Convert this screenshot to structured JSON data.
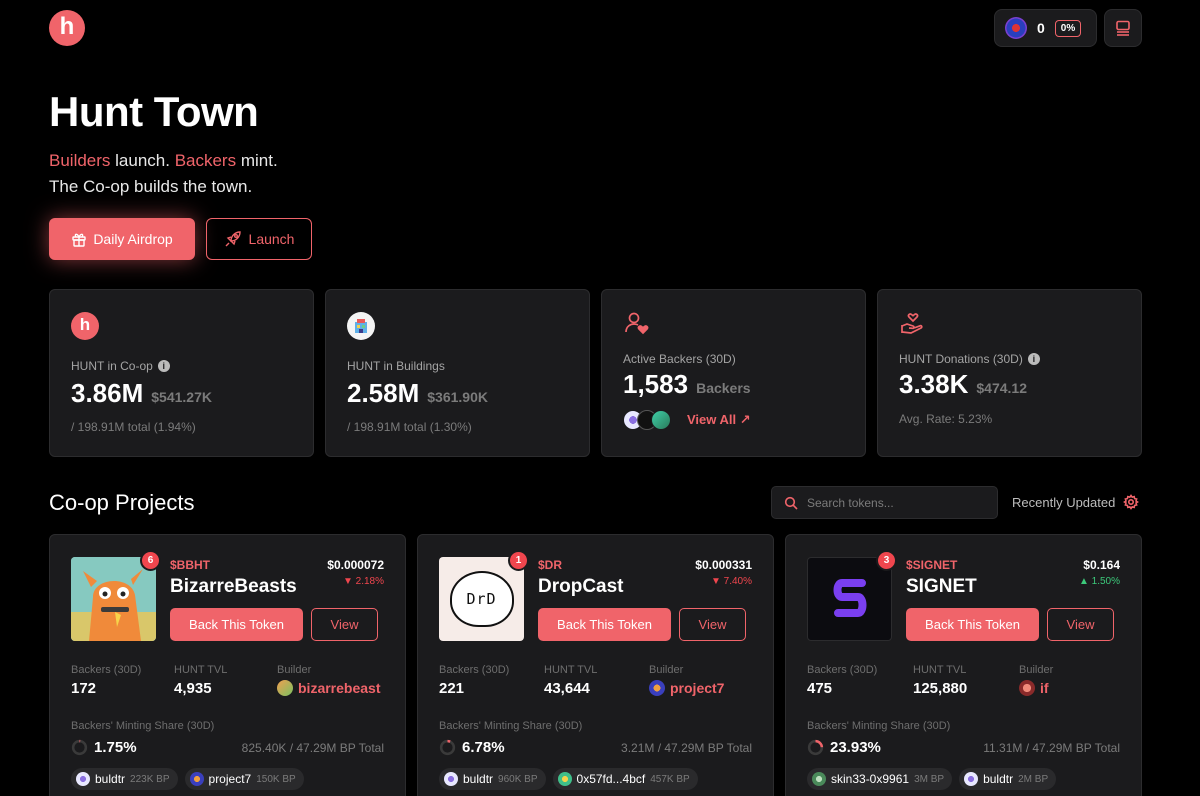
{
  "header": {
    "logo_letter": "h",
    "wallet_count": "0",
    "wallet_pct": "0%"
  },
  "hero": {
    "title": "Hunt Town",
    "line1_builders": "Builders",
    "line1_launch": " launch. ",
    "line1_backers": "Backers",
    "line1_mint": " mint.",
    "line2": "The Co-op builds the town.",
    "airdrop_label": "Daily Airdrop",
    "launch_label": "Launch"
  },
  "stats": [
    {
      "label": "HUNT in Co-op",
      "value": "3.86M",
      "secondary": "$541.27K",
      "foot": "/ 198.91M total (1.94%)",
      "icon": "hunt-logo-icon"
    },
    {
      "label": "HUNT in Buildings",
      "value": "2.58M",
      "secondary": "$361.90K",
      "foot": "/ 198.91M total (1.30%)",
      "icon": "building-icon"
    },
    {
      "label": "Active Backers (30D)",
      "value": "1,583",
      "secondary": "Backers",
      "link": "View All ↗",
      "icon": "user-heart-icon"
    },
    {
      "label": "HUNT Donations (30D)",
      "value": "3.38K",
      "secondary": "$474.12",
      "foot": "Avg. Rate: 5.23%",
      "icon": "hand-heart-icon"
    }
  ],
  "projects_section": {
    "title": "Co-op Projects",
    "search_placeholder": "Search tokens...",
    "sort_label": "Recently Updated"
  },
  "projects": [
    {
      "rank": "6",
      "ticker": "$BBHT",
      "name": "BizarreBeasts",
      "price": "$0.000072",
      "change": "▼ 2.18%",
      "backers_label": "Backers (30D)",
      "backers": "172",
      "tvl_label": "HUNT TVL",
      "tvl": "4,935",
      "builder_label": "Builder",
      "builder": "bizarrebeast",
      "share_label": "Backers' Minting Share (30D)",
      "share_pct": "1.75%",
      "share_total": "825.40K / 47.29M BP Total",
      "chips": [
        {
          "name": "buldtr",
          "bp": "223K BP"
        },
        {
          "name": "project7",
          "bp": "150K BP"
        }
      ]
    },
    {
      "rank": "1",
      "ticker": "$DR",
      "name": "DropCast",
      "price": "$0.000331",
      "change": "▼ 7.40%",
      "backers_label": "Backers (30D)",
      "backers": "221",
      "tvl_label": "HUNT TVL",
      "tvl": "43,644",
      "builder_label": "Builder",
      "builder": "project7",
      "share_label": "Backers' Minting Share (30D)",
      "share_pct": "6.78%",
      "share_total": "3.21M / 47.29M BP Total",
      "thumb_text": "DrD",
      "chips": [
        {
          "name": "buldtr",
          "bp": "960K BP"
        },
        {
          "name": "0x57fd...4bcf",
          "bp": "457K BP"
        }
      ]
    },
    {
      "rank": "3",
      "ticker": "$SIGNET",
      "name": "SIGNET",
      "price": "$0.164",
      "change": "▲ 1.50%",
      "backers_label": "Backers (30D)",
      "backers": "475",
      "tvl_label": "HUNT TVL",
      "tvl": "125,880",
      "builder_label": "Builder",
      "builder": "if",
      "share_label": "Backers' Minting Share (30D)",
      "share_pct": "23.93%",
      "share_total": "11.31M / 47.29M BP Total",
      "chips": [
        {
          "name": "skin33-0x9961",
          "bp": "3M BP"
        },
        {
          "name": "buldtr",
          "bp": "2M BP"
        }
      ]
    }
  ],
  "button_labels": {
    "back": "Back This Token",
    "view": "View"
  },
  "colors": {
    "accent": "#f0646a",
    "background": "#000000",
    "card": "#1b1b1d",
    "down": "#f0464e",
    "up": "#3cc87a"
  }
}
